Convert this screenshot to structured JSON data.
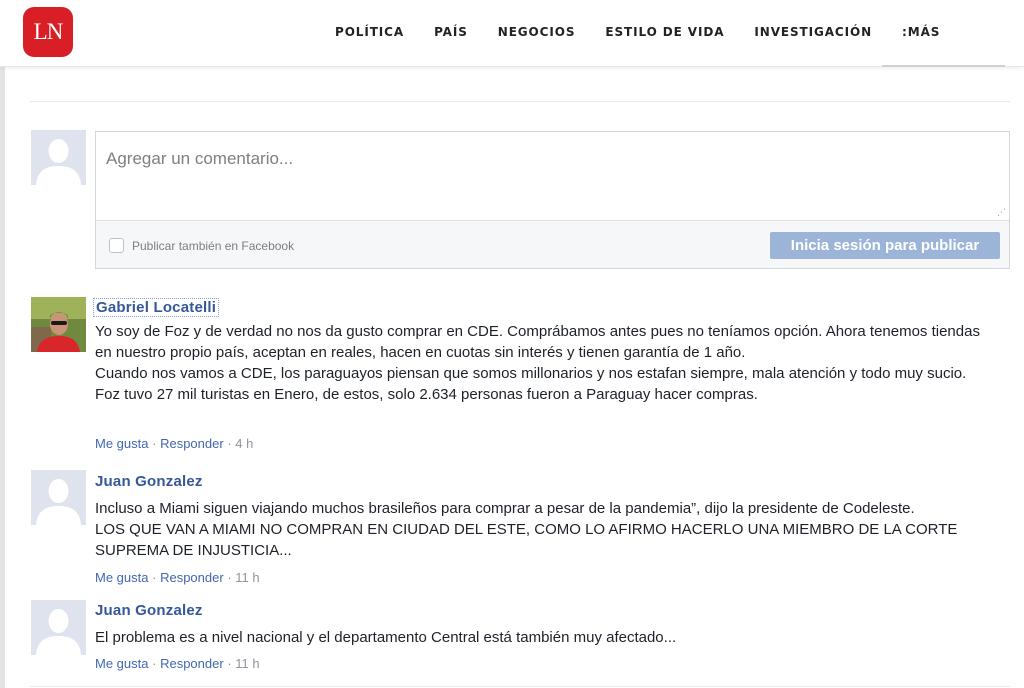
{
  "site": {
    "logo_text": "LN",
    "brand_color": "#d81f26"
  },
  "nav": {
    "items": [
      "POLÍTICA",
      "PAÍS",
      "NEGOCIOS",
      "ESTILO DE VIDA",
      "INVESTIGACIÓN",
      ":MÁS"
    ]
  },
  "composer": {
    "placeholder": "Agregar un comentario...",
    "facebook_checkbox_label": "Publicar también en Facebook",
    "facebook_checked": false,
    "post_button_label": "Inicia sesión para publicar",
    "post_button_color": "#9cb4d8"
  },
  "comments": [
    {
      "author": "Gabriel Locatelli",
      "avatar": "user-photo",
      "paragraphs": [
        "Yo soy de Foz y de verdad no nos da gusto comprar en CDE. Comprábamos antes pues no teníamos opción. Ahora tenemos tiendas en nuestro propio país, aceptan en reales, hacen en cuotas sin interés y tienen garantía de 1 año.",
        "Cuando nos vamos a CDE, los paraguayos piensan que somos millonarios y nos estafan siempre, mala atención y todo muy sucio.",
        "Foz tuvo 27 mil turistas en Enero, de estos, solo 2.634 personas fueron a Paraguay hacer compras."
      ],
      "like_label": "Me gusta",
      "reply_label": "Responder",
      "separator": "·",
      "time": "4 h"
    },
    {
      "author": "Juan Gonzalez",
      "avatar": "default-avatar",
      "paragraphs": [
        "Incluso a Miami siguen viajando muchos brasileños para comprar a pesar de la pandemia”, dijo la presidente de Codeleste.",
        "LOS QUE VAN A MIAMI NO COMPRAN EN CIUDAD DEL ESTE, COMO LO AFIRMO HACERLO UNA MIEMBRO DE LA CORTE SUPREMA DE INJUSTICIA..."
      ],
      "like_label": "Me gusta",
      "reply_label": "Responder",
      "separator": "·",
      "time": "11 h"
    },
    {
      "author": "Juan Gonzalez",
      "avatar": "default-avatar",
      "paragraphs": [
        "El problema es a nivel nacional y el departamento Central está también muy afectado..."
      ],
      "like_label": "Me gusta",
      "reply_label": "Responder",
      "separator": "·",
      "time": "11 h"
    }
  ],
  "colors": {
    "link_blue": "#365899",
    "action_blue": "#4267b2",
    "meta_gray": "#90949c"
  }
}
